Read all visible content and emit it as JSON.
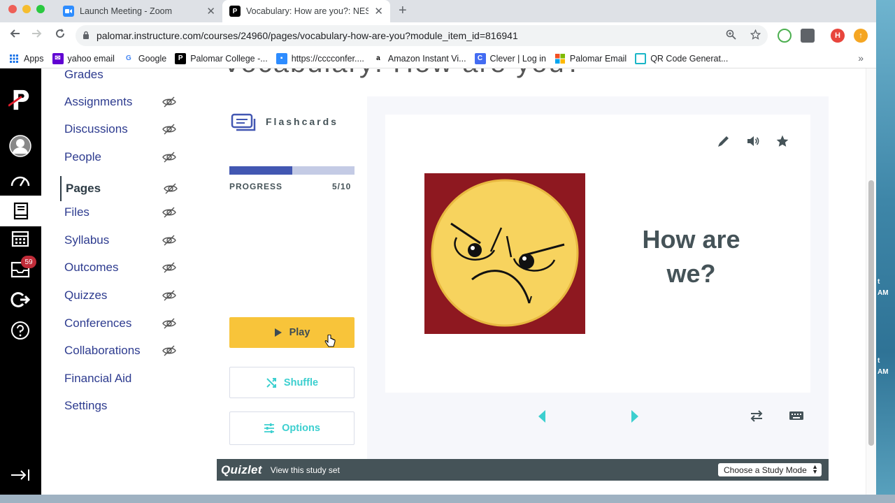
{
  "browser": {
    "tabs": [
      {
        "title": "Launch Meeting - Zoom",
        "favicon": "zoom-icon",
        "active": false
      },
      {
        "title": "Vocabulary: How are you?: NES",
        "favicon": "palomar-p-icon",
        "active": true
      }
    ],
    "url": "palomar.instructure.com/courses/24960/pages/vocabulary-how-are-you?module_item_id=816941",
    "profile_initial": "H",
    "bookmarks": [
      {
        "label": "Apps",
        "icon": "apps-grid-icon"
      },
      {
        "label": "yahoo email",
        "icon": "yahoo-icon"
      },
      {
        "label": "Google",
        "icon": "google-icon"
      },
      {
        "label": "Palomar College -...",
        "icon": "palomar-p-icon"
      },
      {
        "label": "https://cccconfer....",
        "icon": "zoom-icon"
      },
      {
        "label": "Amazon Instant Vi...",
        "icon": "amazon-icon"
      },
      {
        "label": "Clever | Log in",
        "icon": "clever-icon"
      },
      {
        "label": "Palomar Email",
        "icon": "microsoft-icon"
      },
      {
        "label": "QR Code Generat...",
        "icon": "qr-icon"
      }
    ]
  },
  "global_nav": {
    "inbox_badge": "59"
  },
  "course_nav": {
    "items": [
      {
        "label": "Grades",
        "hidden_icon": false
      },
      {
        "label": "Assignments",
        "hidden_icon": true
      },
      {
        "label": "Discussions",
        "hidden_icon": true
      },
      {
        "label": "People",
        "hidden_icon": true
      },
      {
        "label": "Pages",
        "hidden_icon": true,
        "active": true
      },
      {
        "label": "Files",
        "hidden_icon": true
      },
      {
        "label": "Syllabus",
        "hidden_icon": true
      },
      {
        "label": "Outcomes",
        "hidden_icon": true
      },
      {
        "label": "Quizzes",
        "hidden_icon": true
      },
      {
        "label": "Conferences",
        "hidden_icon": true
      },
      {
        "label": "Collaborations",
        "hidden_icon": true
      },
      {
        "label": "Financial Aid",
        "hidden_icon": false
      },
      {
        "label": "Settings",
        "hidden_icon": false
      }
    ]
  },
  "page_title": "Vocabulary: How are you?",
  "quizlet": {
    "mode_label": "Flashcards",
    "progress_label": "PROGRESS",
    "progress_text": "5/10",
    "progress_fraction": 0.5,
    "play_label": "Play",
    "shuffle_label": "Shuffle",
    "options_label": "Options",
    "card_word": "How are we?",
    "card_image": "angry-face-emoji",
    "footer_logo": "Quizlet",
    "footer_view": "View this study set",
    "study_mode_select": "Choose a Study Mode"
  },
  "desktop": {
    "clock_fragments": [
      "t",
      "AM",
      "t",
      "AM"
    ]
  },
  "colors": {
    "canvas_nav_bg": "#000000",
    "canvas_link": "#2d3b8f",
    "quizlet_yellow": "#f8c43a",
    "quizlet_teal": "#3ccfcf",
    "quizlet_blue": "#4257b2",
    "quizlet_slate": "#455358",
    "card_image_bg": "#8e1820"
  }
}
